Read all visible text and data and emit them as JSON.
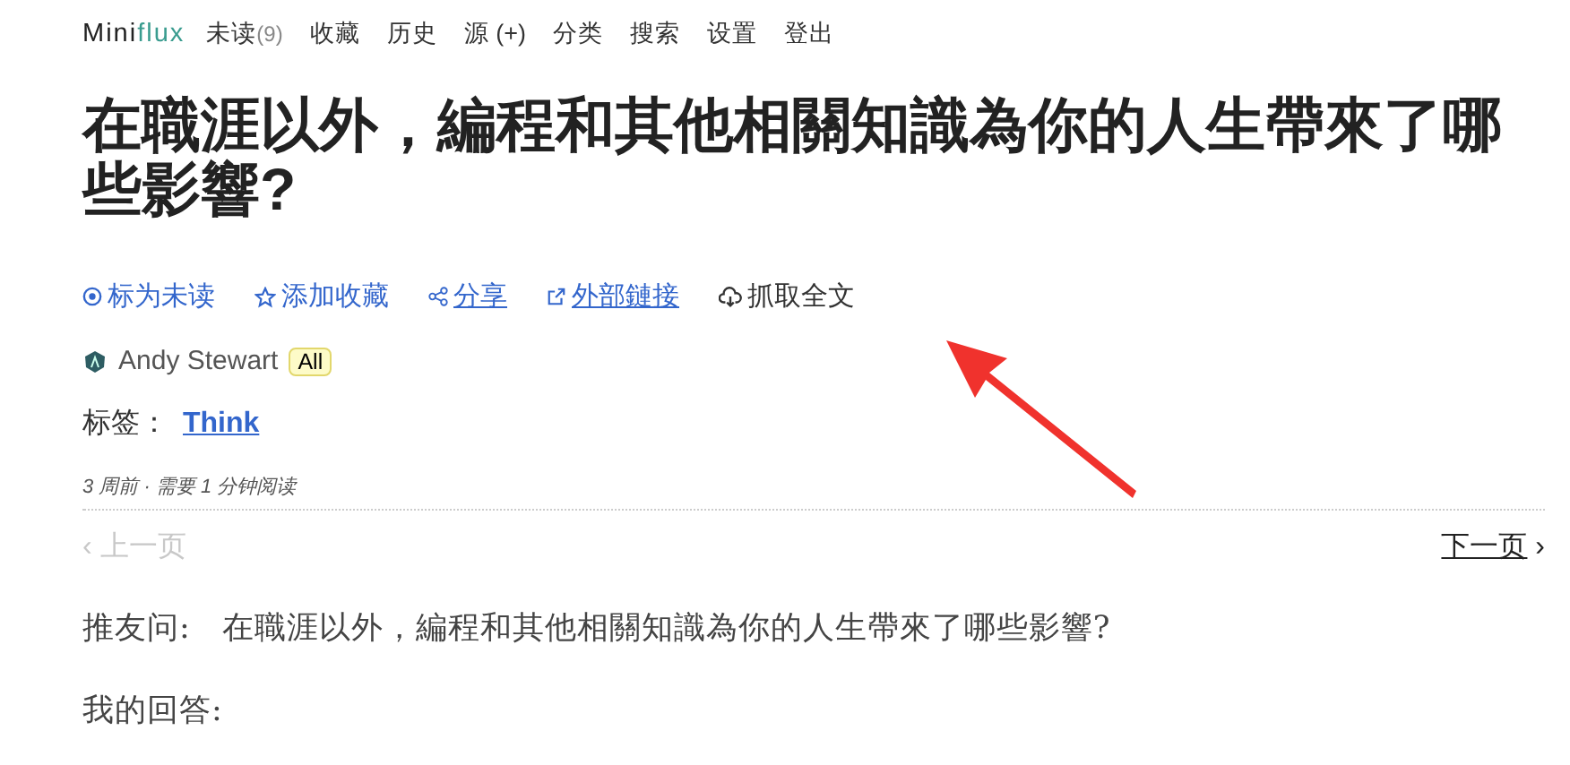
{
  "header": {
    "logo": {
      "part_1": "Mini",
      "part_2": "flux"
    },
    "nav": [
      {
        "label": "未读",
        "count": "(9)"
      },
      {
        "label": "收藏"
      },
      {
        "label": "历史"
      },
      {
        "label": "源 (+)"
      },
      {
        "label": "分类"
      },
      {
        "label": "搜索"
      },
      {
        "label": "设置"
      },
      {
        "label": "登出"
      }
    ]
  },
  "entry": {
    "title": "在職涯以外，編程和其他相關知識為你的人生帶來了哪些影響?",
    "actions": [
      {
        "kind": "button",
        "label": "标为未读"
      },
      {
        "kind": "button",
        "label": "添加收藏"
      },
      {
        "kind": "link",
        "label": "分享"
      },
      {
        "kind": "link",
        "label": "外部鏈接"
      },
      {
        "kind": "plain",
        "label": "抓取全文"
      }
    ],
    "author": "Andy Stewart",
    "category": "All",
    "tags_label": "标签：",
    "tags": [
      "Think"
    ],
    "meta": "3 周前 · 需要 1 分钟阅读"
  },
  "pagination": {
    "prev": {
      "chevron": "‹",
      "label": "上一页",
      "disabled": true
    },
    "next": {
      "label": "下一页",
      "chevron": "›",
      "disabled": false
    }
  },
  "content": [
    "推友问:　在職涯以外，編程和其他相關知識為你的人生帶來了哪些影響?",
    "我的回答:"
  ]
}
